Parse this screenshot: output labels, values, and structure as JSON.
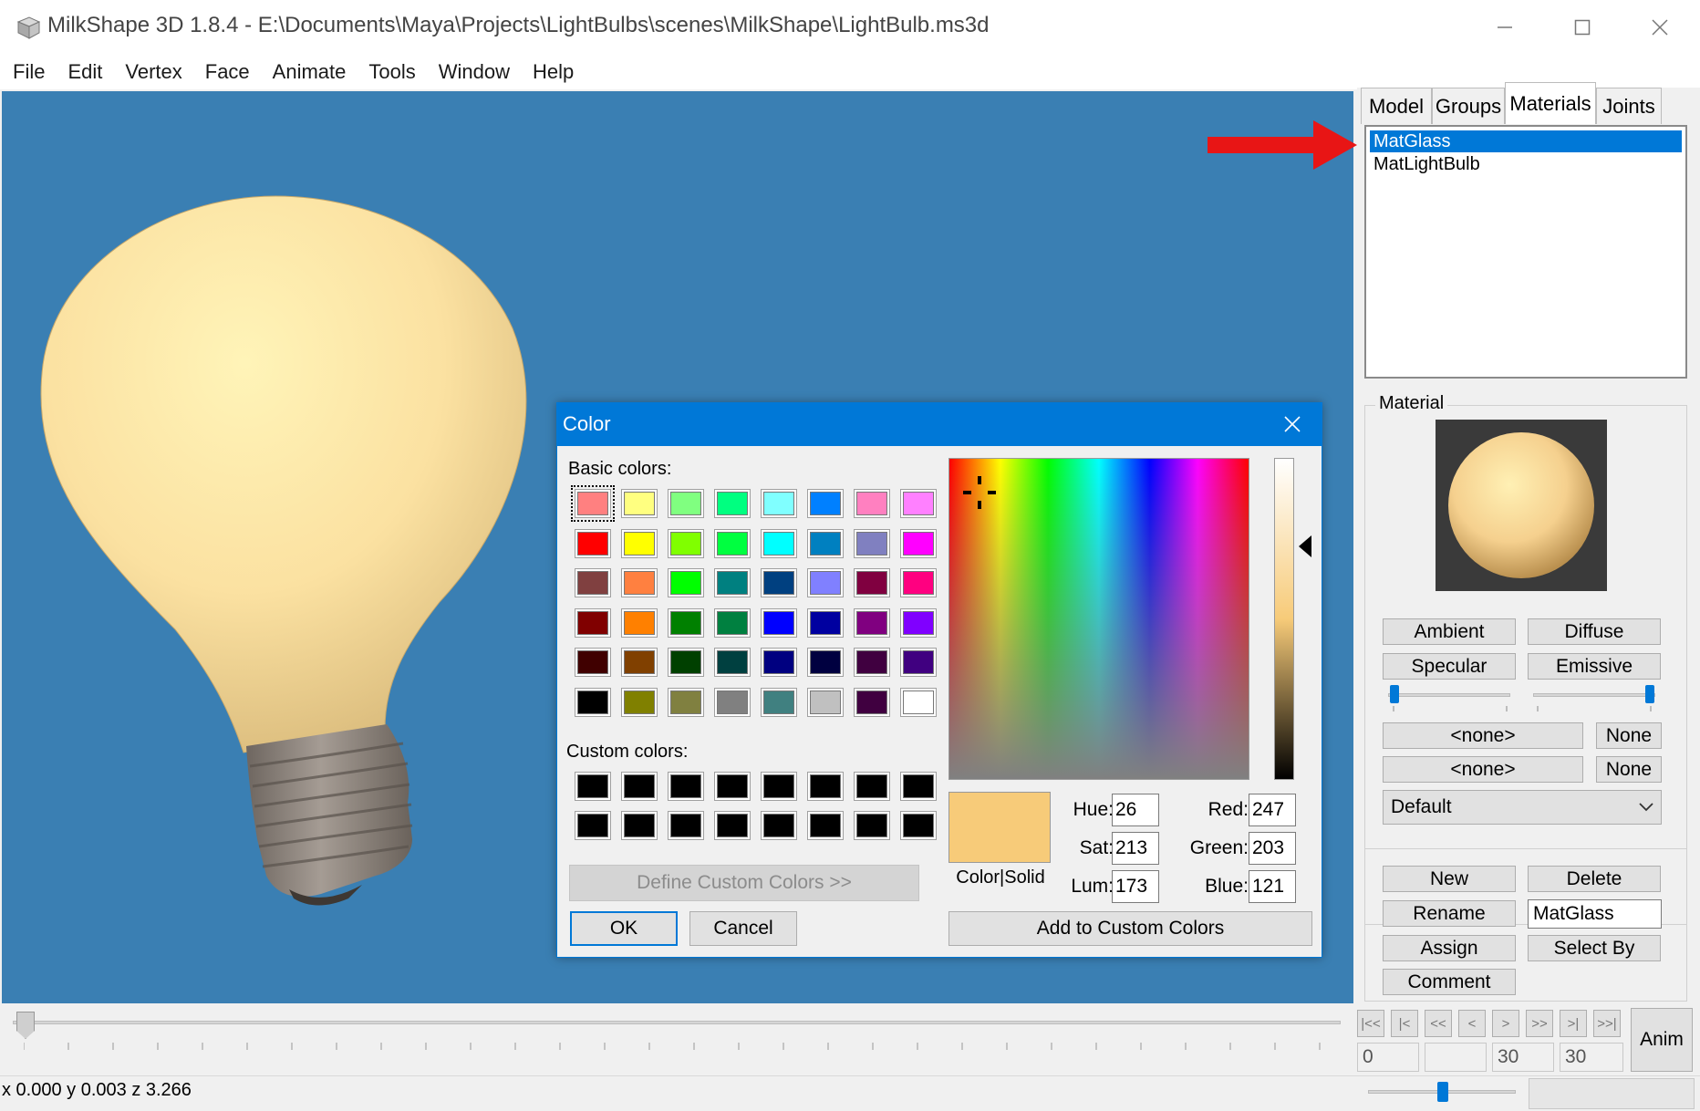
{
  "window": {
    "title": "MilkShape 3D 1.8.4 - E:\\Documents\\Maya\\Projects\\LightBulbs\\scenes\\MilkShape\\LightBulb.ms3d",
    "app_icon": "milkshape-cube-icon",
    "controls": [
      "minimize-icon",
      "maximize-icon",
      "close-icon"
    ]
  },
  "menu": [
    "File",
    "Edit",
    "Vertex",
    "Face",
    "Animate",
    "Tools",
    "Window",
    "Help"
  ],
  "viewport": {
    "background": "#3a7fb3",
    "object": "light-bulb-model"
  },
  "right_panel": {
    "tabs": [
      {
        "label": "Model",
        "active": false
      },
      {
        "label": "Groups",
        "active": false
      },
      {
        "label": "Materials",
        "active": true
      },
      {
        "label": "Joints",
        "active": false
      }
    ],
    "materials": [
      {
        "name": "MatGlass",
        "selected": true
      },
      {
        "name": "MatLightBulb",
        "selected": false
      }
    ],
    "material_group": {
      "label": "Material",
      "preview_color": "#f7cb79",
      "ambient_label": "Ambient",
      "diffuse_label": "Diffuse",
      "specular_label": "Specular",
      "emissive_label": "Emissive",
      "texture1": "<none>",
      "texture1_clear": "None",
      "texture2": "<none>",
      "texture2_clear": "None",
      "mode_select": "Default"
    },
    "actions": {
      "new_label": "New",
      "delete_label": "Delete",
      "rename_label": "Rename",
      "name_value": "MatGlass",
      "assign_label": "Assign",
      "select_by_label": "Select By",
      "comment_label": "Comment"
    }
  },
  "timeline": {
    "buttons": [
      "|<<",
      "|<",
      "<<",
      "<",
      ">",
      ">>",
      ">|",
      ">>|"
    ],
    "frame_fields": [
      "0",
      "",
      "30",
      "30"
    ],
    "anim_label": "Anim"
  },
  "status": {
    "coords": "x 0.000 y 0.003 z 3.266"
  },
  "color_dialog": {
    "title": "Color",
    "basic_label": "Basic colors:",
    "custom_label": "Custom colors:",
    "basic_colors": [
      "#ff8080",
      "#ffff80",
      "#80ff80",
      "#00ff80",
      "#80ffff",
      "#0080ff",
      "#ff80c0",
      "#ff80ff",
      "#ff0000",
      "#ffff00",
      "#80ff00",
      "#00ff40",
      "#00ffff",
      "#0080c0",
      "#8080c0",
      "#ff00ff",
      "#804040",
      "#ff8040",
      "#00ff00",
      "#008080",
      "#004080",
      "#8080ff",
      "#800040",
      "#ff0080",
      "#800000",
      "#ff8000",
      "#008000",
      "#008040",
      "#0000ff",
      "#0000a0",
      "#800080",
      "#8000ff",
      "#400000",
      "#804000",
      "#004000",
      "#004040",
      "#000080",
      "#000040",
      "#400040",
      "#400080",
      "#000000",
      "#808000",
      "#808040",
      "#808080",
      "#408080",
      "#c0c0c0",
      "#400040",
      "#ffffff"
    ],
    "custom_colors": [
      "#000000",
      "#000000",
      "#000000",
      "#000000",
      "#000000",
      "#000000",
      "#000000",
      "#000000",
      "#000000",
      "#000000",
      "#000000",
      "#000000",
      "#000000",
      "#000000",
      "#000000",
      "#000000"
    ],
    "define_custom_label": "Define Custom Colors >>",
    "ok_label": "OK",
    "cancel_label": "Cancel",
    "preview_label": "Color|Solid",
    "preview_color": "#f7cb79",
    "hue_label": "Hue:",
    "hue": "26",
    "sat_label": "Sat:",
    "sat": "213",
    "lum_label": "Lum:",
    "lum": "173",
    "red_label": "Red:",
    "red": "247",
    "green_label": "Green:",
    "green": "203",
    "blue_label": "Blue:",
    "blue": "121",
    "add_custom_label": "Add to Custom Colors"
  },
  "annotations": {
    "arrow_color": "#e81515"
  }
}
